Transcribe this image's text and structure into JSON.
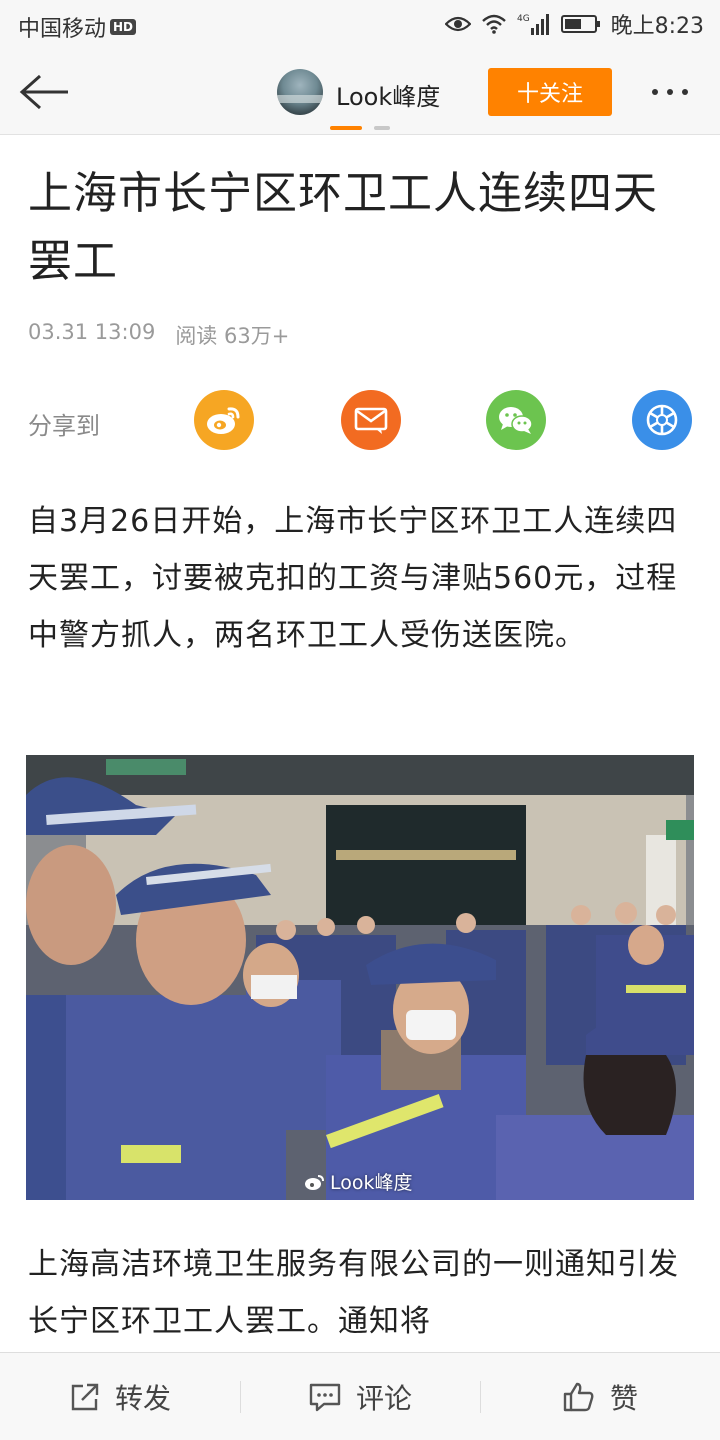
{
  "status_bar": {
    "carrier": "中国移动",
    "hd_badge": "HD",
    "network": "4G",
    "time": "晚上8:23"
  },
  "header": {
    "account_name": "Look峰度",
    "follow_label": "十关注",
    "accent_color": "#ff8200"
  },
  "article": {
    "title": "上海市长宁区环卫工人连续四天罢工",
    "date": "03.31 13:09",
    "reads": "阅读 63万+",
    "share_label": "分享到",
    "paragraph_1": "自3月26日开始，上海市长宁区环卫工人连续四天罢工，讨要被克扣的工资与津贴560元，过程中警方抓人，两名环卫工人受伤送医院。",
    "image_watermark": "Look峰度",
    "paragraph_2": "上海高洁环境卫生服务有限公司的一则通知引发长宁区环卫工人罢工。通知将"
  },
  "share_icons": [
    "weibo-icon",
    "mail-icon",
    "wechat-icon",
    "moments-icon"
  ],
  "bottom_bar": {
    "repost_label": "转发",
    "comment_label": "评论",
    "like_label": "赞"
  }
}
